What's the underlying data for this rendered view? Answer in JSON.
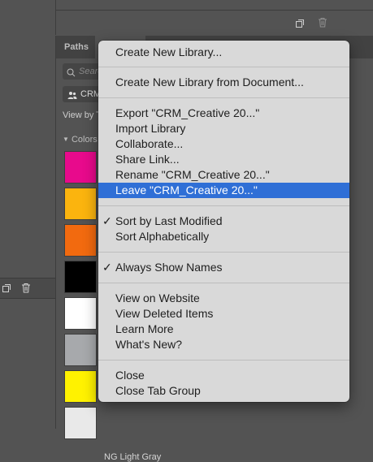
{
  "left_panel": {
    "icons": [
      "new-layer-icon",
      "trash-icon"
    ]
  },
  "panel": {
    "tabs": [
      {
        "label": "Paths",
        "active": false
      },
      {
        "label": "",
        "active": true
      }
    ],
    "search": {
      "placeholder": "Searc"
    },
    "library_selector": {
      "value": "CRM"
    },
    "view_by": "View by T",
    "section_label": "Colors",
    "swatches": [
      {
        "color": "#e80a8c"
      },
      {
        "color": "#fbb40e"
      },
      {
        "color": "#f26a0f"
      },
      {
        "color": "#000000"
      },
      {
        "color": "#ffffff"
      },
      {
        "color": "#a7a9ac"
      },
      {
        "color": "#fff200"
      },
      {
        "color": "#e9e9e9"
      }
    ],
    "bottom_swatch_label": "NG Light Gray"
  },
  "menu": {
    "items": [
      {
        "label": "Create New Library...",
        "check": "",
        "highlighted": false
      },
      {
        "label": "Create New Library from Document...",
        "check": "",
        "highlighted": false
      },
      {
        "label": "Export \"CRM_Creative 20...\"",
        "check": "",
        "highlighted": false
      },
      {
        "label": "Import Library",
        "check": "",
        "highlighted": false
      },
      {
        "label": "Collaborate...",
        "check": "",
        "highlighted": false
      },
      {
        "label": "Share Link...",
        "check": "",
        "highlighted": false
      },
      {
        "label": "Rename \"CRM_Creative 20...\"",
        "check": "",
        "highlighted": false
      },
      {
        "label": "Leave \"CRM_Creative 20...\"",
        "check": "",
        "highlighted": true
      },
      {
        "label": "Sort by Last Modified",
        "check": "✓",
        "highlighted": false
      },
      {
        "label": "Sort Alphabetically",
        "check": "",
        "highlighted": false
      },
      {
        "label": "Always Show Names",
        "check": "✓",
        "highlighted": false
      },
      {
        "label": "View on Website",
        "check": "",
        "highlighted": false
      },
      {
        "label": "View Deleted Items",
        "check": "",
        "highlighted": false
      },
      {
        "label": "Learn More",
        "check": "",
        "highlighted": false
      },
      {
        "label": "What's New?",
        "check": "",
        "highlighted": false
      },
      {
        "label": "Close",
        "check": "",
        "highlighted": false
      },
      {
        "label": "Close Tab Group",
        "check": "",
        "highlighted": false
      }
    ]
  }
}
